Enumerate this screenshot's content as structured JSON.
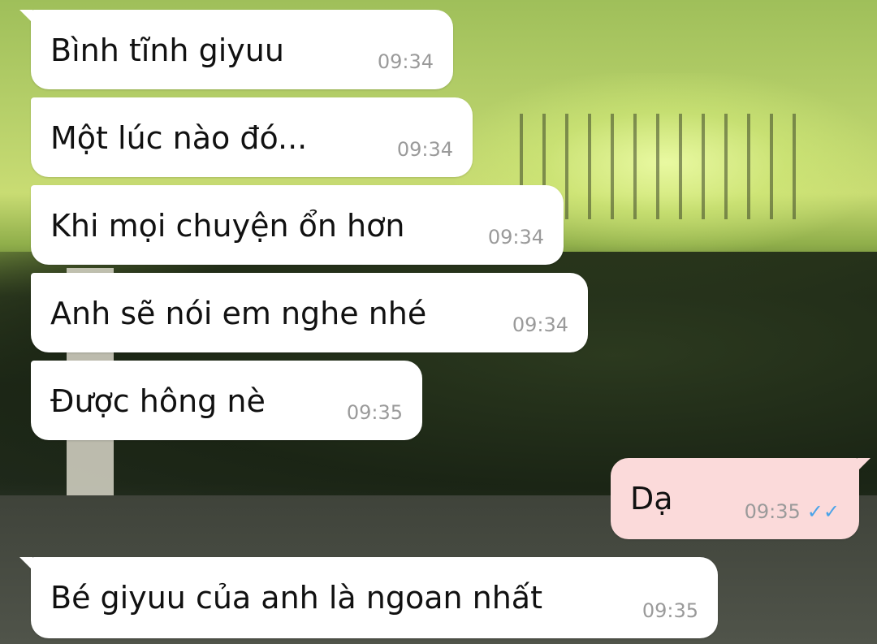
{
  "messages": [
    {
      "direction": "incoming",
      "text": "Bình tĩnh giyuu",
      "time": "09:34"
    },
    {
      "direction": "incoming",
      "text": "Một lúc nào đó...",
      "time": "09:34"
    },
    {
      "direction": "incoming",
      "text": "Khi mọi chuyện ổn hơn",
      "time": "09:34"
    },
    {
      "direction": "incoming",
      "text": "Anh sẽ nói em nghe nhé",
      "time": "09:34"
    },
    {
      "direction": "incoming",
      "text": "Được hông nè",
      "time": "09:35"
    },
    {
      "direction": "outgoing",
      "text": "Dạ",
      "time": "09:35",
      "status_icon": "double-check-icon"
    },
    {
      "direction": "incoming",
      "text": "Bé giyuu của anh là ngoan nhất",
      "time": "09:35"
    }
  ],
  "colors": {
    "incoming_bubble": "#ffffff",
    "outgoing_bubble": "#fbdada",
    "timestamp": "#9a9a9a",
    "read_check": "#4aa3e8"
  }
}
